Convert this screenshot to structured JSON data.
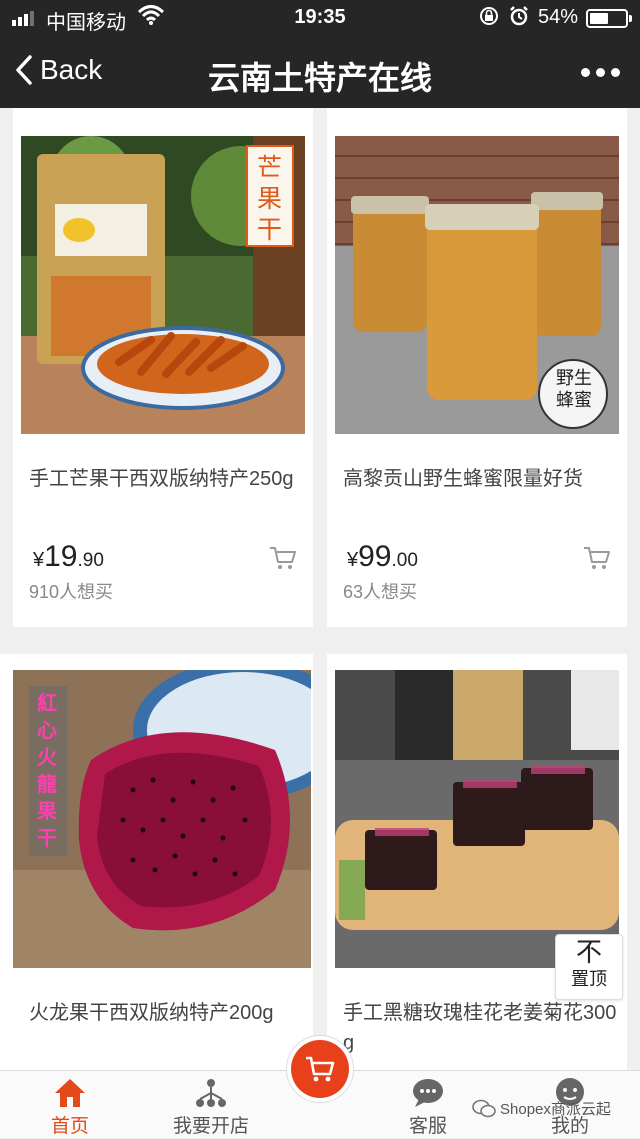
{
  "status_bar": {
    "carrier": "中国移动",
    "time": "19:35",
    "battery_percent": "54%",
    "battery_level": 0.54,
    "signal_bars": 3,
    "icons": [
      "signal-icon",
      "wifi-icon",
      "rotation-lock-icon",
      "alarm-icon",
      "battery-icon"
    ]
  },
  "nav": {
    "back_label": "Back",
    "title": "云南土特产在线",
    "icons": [
      "chevron-left-icon",
      "more-icon"
    ]
  },
  "products": [
    {
      "name": "手工芒果干西双版纳特产250g",
      "price_symbol": "¥",
      "price_int": "19",
      "price_dec": ".90",
      "want": "910人想买",
      "image_label": "芒果干",
      "image_colors": {
        "accent": "#e25a1a",
        "bg": "#3f5a2a"
      }
    },
    {
      "name": "高黎贡山野生蜂蜜限量好货",
      "price_symbol": "¥",
      "price_int": "99",
      "price_dec": ".00",
      "want": "63人想买",
      "image_label": "野生蜂蜜",
      "image_colors": {
        "accent": "#d89a3a",
        "bg": "#9a5a44"
      }
    },
    {
      "name": "火龙果干西双版纳特产200g",
      "price_symbol": "",
      "price_int": "",
      "price_dec": "",
      "want": "",
      "image_label": "紅心火龍果干",
      "image_colors": {
        "accent": "#b0184a",
        "bg": "#8d7258"
      }
    },
    {
      "name": "手工黑糖玫瑰桂花老姜菊花300g",
      "price_symbol": "",
      "price_int": "",
      "price_dec": "",
      "want": "",
      "image_label": "",
      "image_colors": {
        "accent": "#6a2a3a",
        "bg": "#5a5a5a"
      }
    }
  ],
  "to_top": {
    "glyph": "不",
    "label": "置顶"
  },
  "tabbar": {
    "tabs": [
      {
        "label": "首页",
        "icon": "home-icon",
        "active": true
      },
      {
        "label": "我要开店",
        "icon": "network-icon",
        "active": false
      },
      {
        "label": "客服",
        "icon": "chat-bubble-icon",
        "active": false
      },
      {
        "label": "我的",
        "icon": "profile-icon",
        "active": false
      }
    ],
    "cart_icon": "cart-icon"
  },
  "watermark": "Shopex商派云起",
  "colors": {
    "accent": "#e8401a",
    "active_tab": "#e24a1a",
    "nav_bg": "#262626"
  }
}
